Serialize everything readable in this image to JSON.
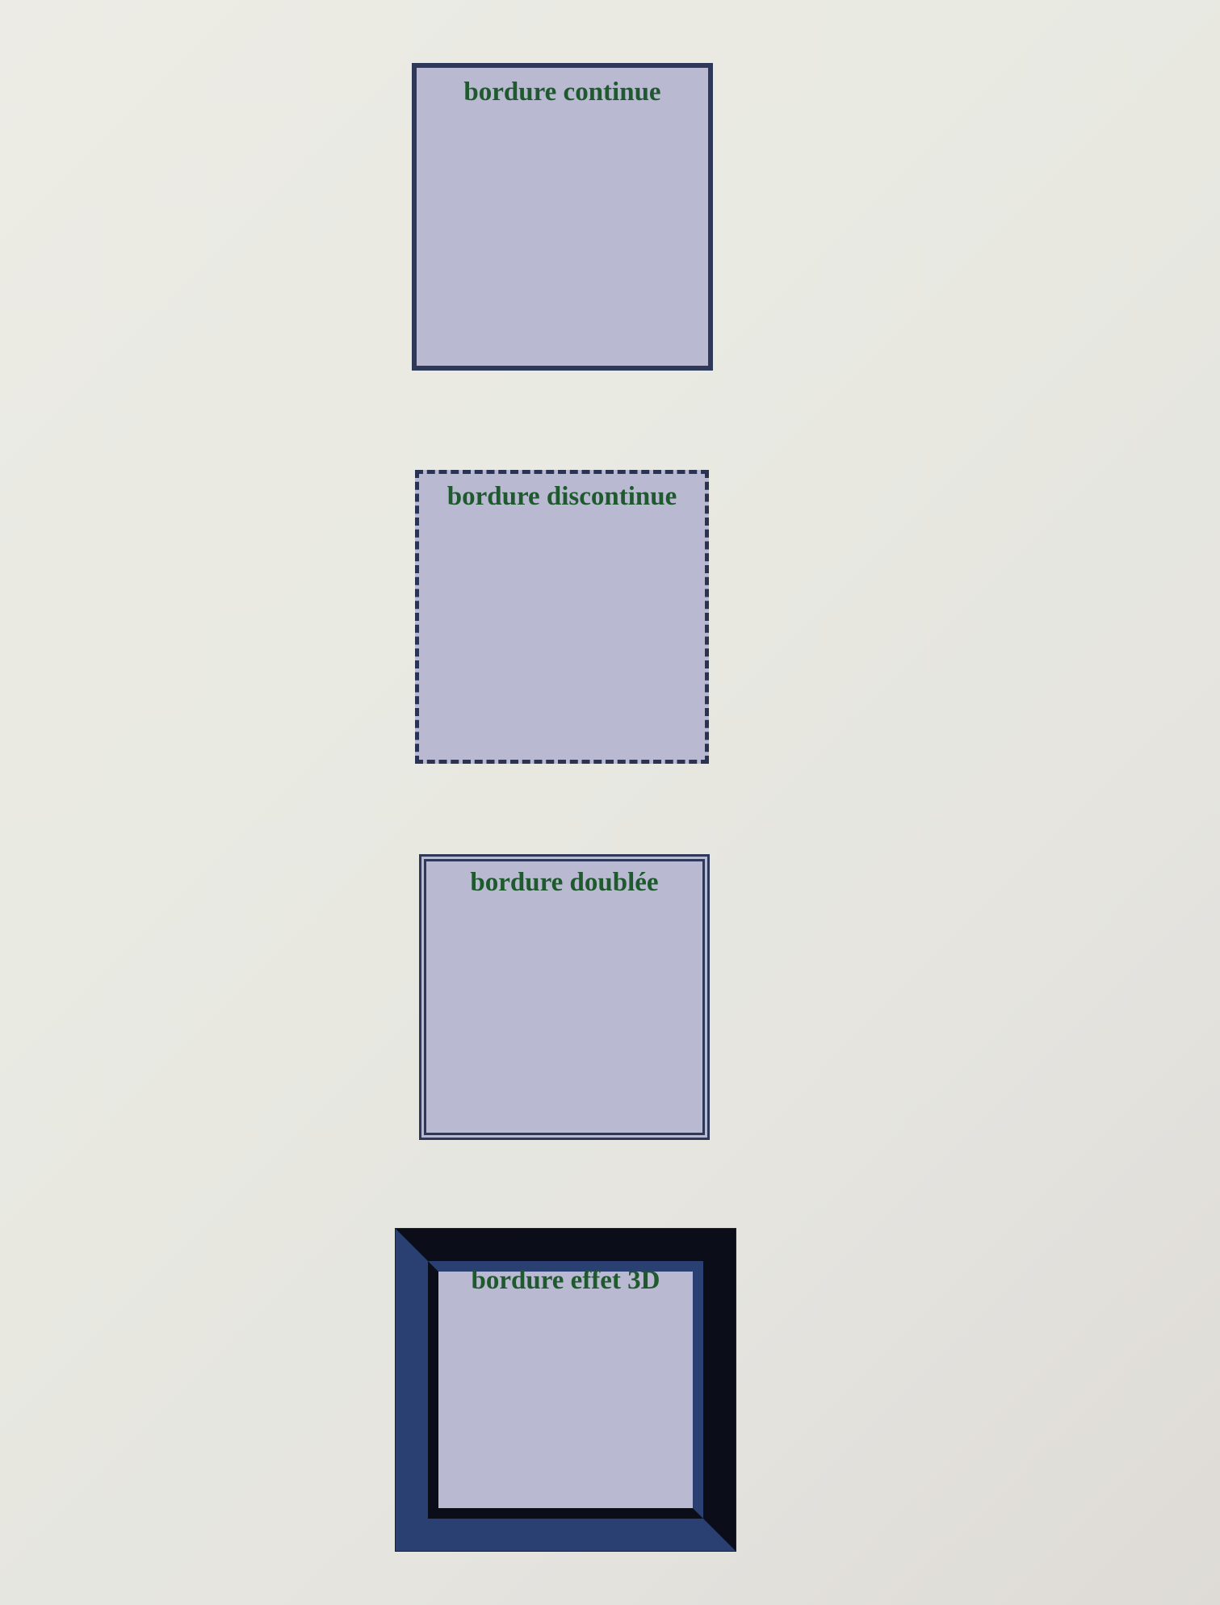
{
  "boxes": [
    {
      "label": "bordure continue"
    },
    {
      "label": "bordure discontinue"
    },
    {
      "label": "bordure doublée"
    },
    {
      "label": "bordure effet 3D"
    }
  ]
}
